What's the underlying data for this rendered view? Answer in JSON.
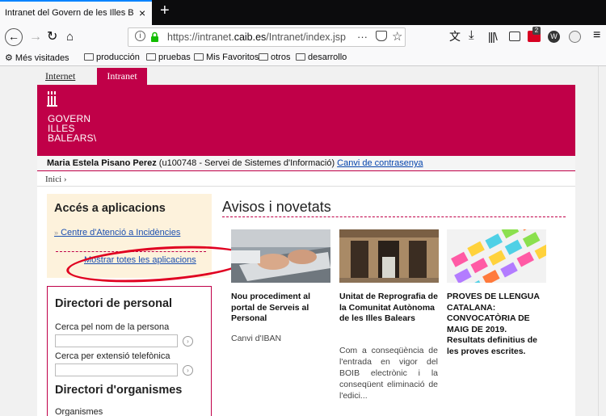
{
  "browser": {
    "tab_title": "Intranet del Govern de les Illes Balea",
    "tab_close": "×",
    "new_tab": "+",
    "url_prefix": "https://intranet.",
    "url_domain": "caib.es",
    "url_path": "/Intranet/index.jsp",
    "url_more": "···",
    "bookmarks": [
      "Més visitades",
      "producción",
      "pruebas",
      "Mis Favoritos",
      "otros",
      "desarrollo"
    ],
    "extension_badge": "2"
  },
  "site": {
    "tab_internet": "Internet",
    "tab_intranet": "Intranet",
    "logo_lines": [
      "GOVERN",
      "ILLES",
      "BALEARS\\"
    ],
    "user_name": "Maria Estela Pisano Perez",
    "user_info": " (u100748 - Servei de Sistemes d'Informació) ",
    "change_password": "Canvi de contrasenya",
    "breadcrumb": "Inici ›",
    "brand_color": "#c00048"
  },
  "apps_panel": {
    "title": "Accés a aplicacions",
    "link_1": "Centre d'Atenció a Incidències",
    "link_2": "Mostrar totes les aplicacions",
    "bullet": "»"
  },
  "dir_panel": {
    "title": "Directori de personal",
    "label_name": "Cerca pel nom de la persona",
    "label_ext": "Cerca per extensió telefònica",
    "go": "›",
    "title_orgs": "Directori d'organismes",
    "label_orgs": "Organismes"
  },
  "news": {
    "title": "Avisos i novetats",
    "items": [
      {
        "headline": "Nou procediment al portal de Serveis al Personal",
        "sub": "Canvi d'IBAN",
        "body": ""
      },
      {
        "headline": "Unitat de Reprografia de la Comunitat Autònoma de les Illes Balears",
        "sub": "",
        "body": "Com a conseqüència de l'entrada en vigor del BOIB electrònic i la conseqüent eliminació de l'edici..."
      },
      {
        "headline": "PROVES DE LLENGUA CATALANA: CONVOCATÒRIA DE MAIG DE 2019. Resultats definitius de les proves escrites.",
        "sub": "",
        "body": ""
      }
    ]
  }
}
